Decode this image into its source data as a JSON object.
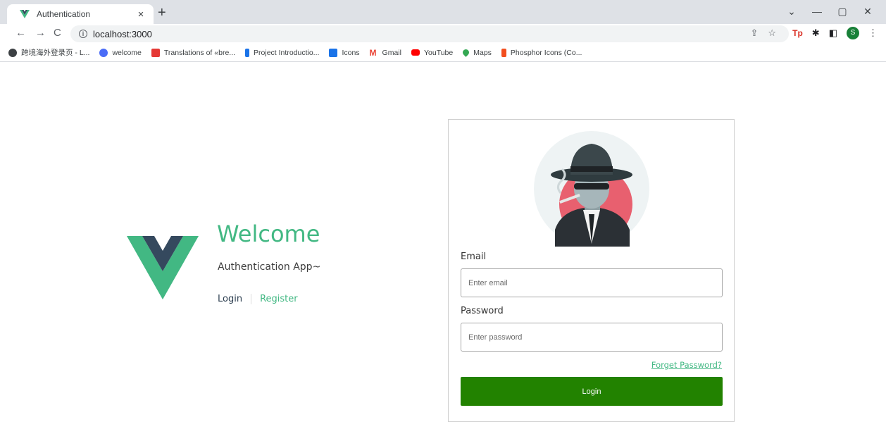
{
  "browser": {
    "tab_title": "Authentication",
    "url": "localhost:3000",
    "profile_initial": "S",
    "bookmarks": [
      {
        "label": "跨境海外登录页 - L...",
        "icon": "globe-icon",
        "color": "#3c4043"
      },
      {
        "label": "welcome",
        "icon": "app-icon",
        "color": "#4a6cf7"
      },
      {
        "label": "Translations of «bre...",
        "icon": "translate-icon",
        "color": "#e53935"
      },
      {
        "label": "Project Introductio...",
        "icon": "doc-icon",
        "color": "#1a73e8"
      },
      {
        "label": "Icons",
        "icon": "icons-icon",
        "color": "#1a73e8"
      },
      {
        "label": "Gmail",
        "icon": "gmail-icon",
        "color": "#ea4335"
      },
      {
        "label": "YouTube",
        "icon": "youtube-icon",
        "color": "#ff0000"
      },
      {
        "label": "Maps",
        "icon": "maps-icon",
        "color": "#34a853"
      },
      {
        "label": "Phosphor Icons (Co...",
        "icon": "figma-icon",
        "color": "#f24e1e"
      }
    ]
  },
  "hero": {
    "title": "Welcome",
    "subtitle": "Authentication App~",
    "login_link": "Login",
    "register_link": "Register"
  },
  "form": {
    "email_label": "Email",
    "email_placeholder": "Enter email",
    "password_label": "Password",
    "password_placeholder": "Enter password",
    "forget_link": "Forget Password?",
    "login_button": "Login"
  },
  "colors": {
    "accent": "#42b883",
    "vue_dark": "#35495e",
    "button": "#228200"
  }
}
